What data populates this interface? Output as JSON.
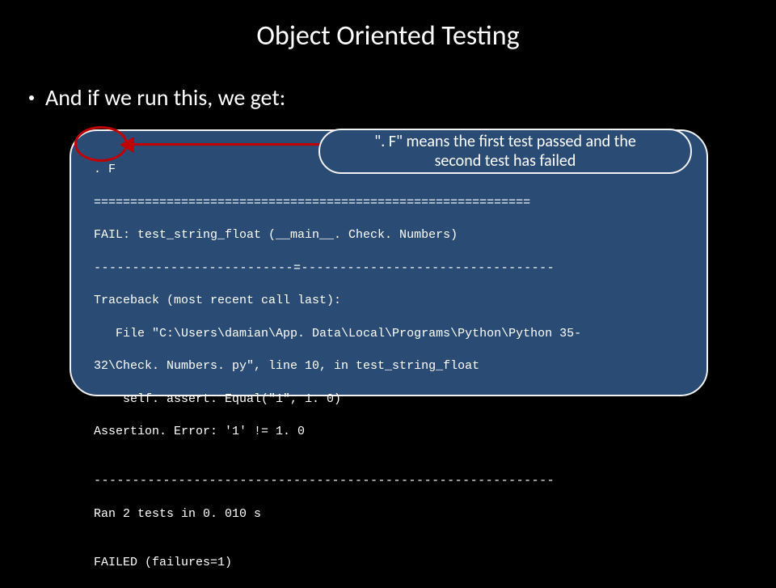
{
  "title": "Object Oriented Testing",
  "bullet": "And if we run this, we get:",
  "callout": {
    "line1": "\". F\" means the first test passed and the",
    "line2": "second test has failed"
  },
  "code": {
    "l1": ". F",
    "l2": "============================================================",
    "l3": "FAIL: test_string_float (__main__. Check. Numbers)",
    "l4": "--------------------------=---------------------------------",
    "l5": "Traceback (most recent call last):",
    "l6": "   File \"C:\\Users\\damian\\App. Data\\Local\\Programs\\Python\\Python 35-",
    "l7": "32\\Check. Numbers. py\", line 10, in test_string_float",
    "l8": "    self. assert. Equal(\"1\", 1. 0)",
    "l9": "Assertion. Error: '1' != 1. 0",
    "l10": "",
    "l11": "------------------------------------------------------------",
    "l12": "Ran 2 tests in 0. 010 s",
    "l13": "",
    "l14": "FAILED (failures=1)"
  }
}
